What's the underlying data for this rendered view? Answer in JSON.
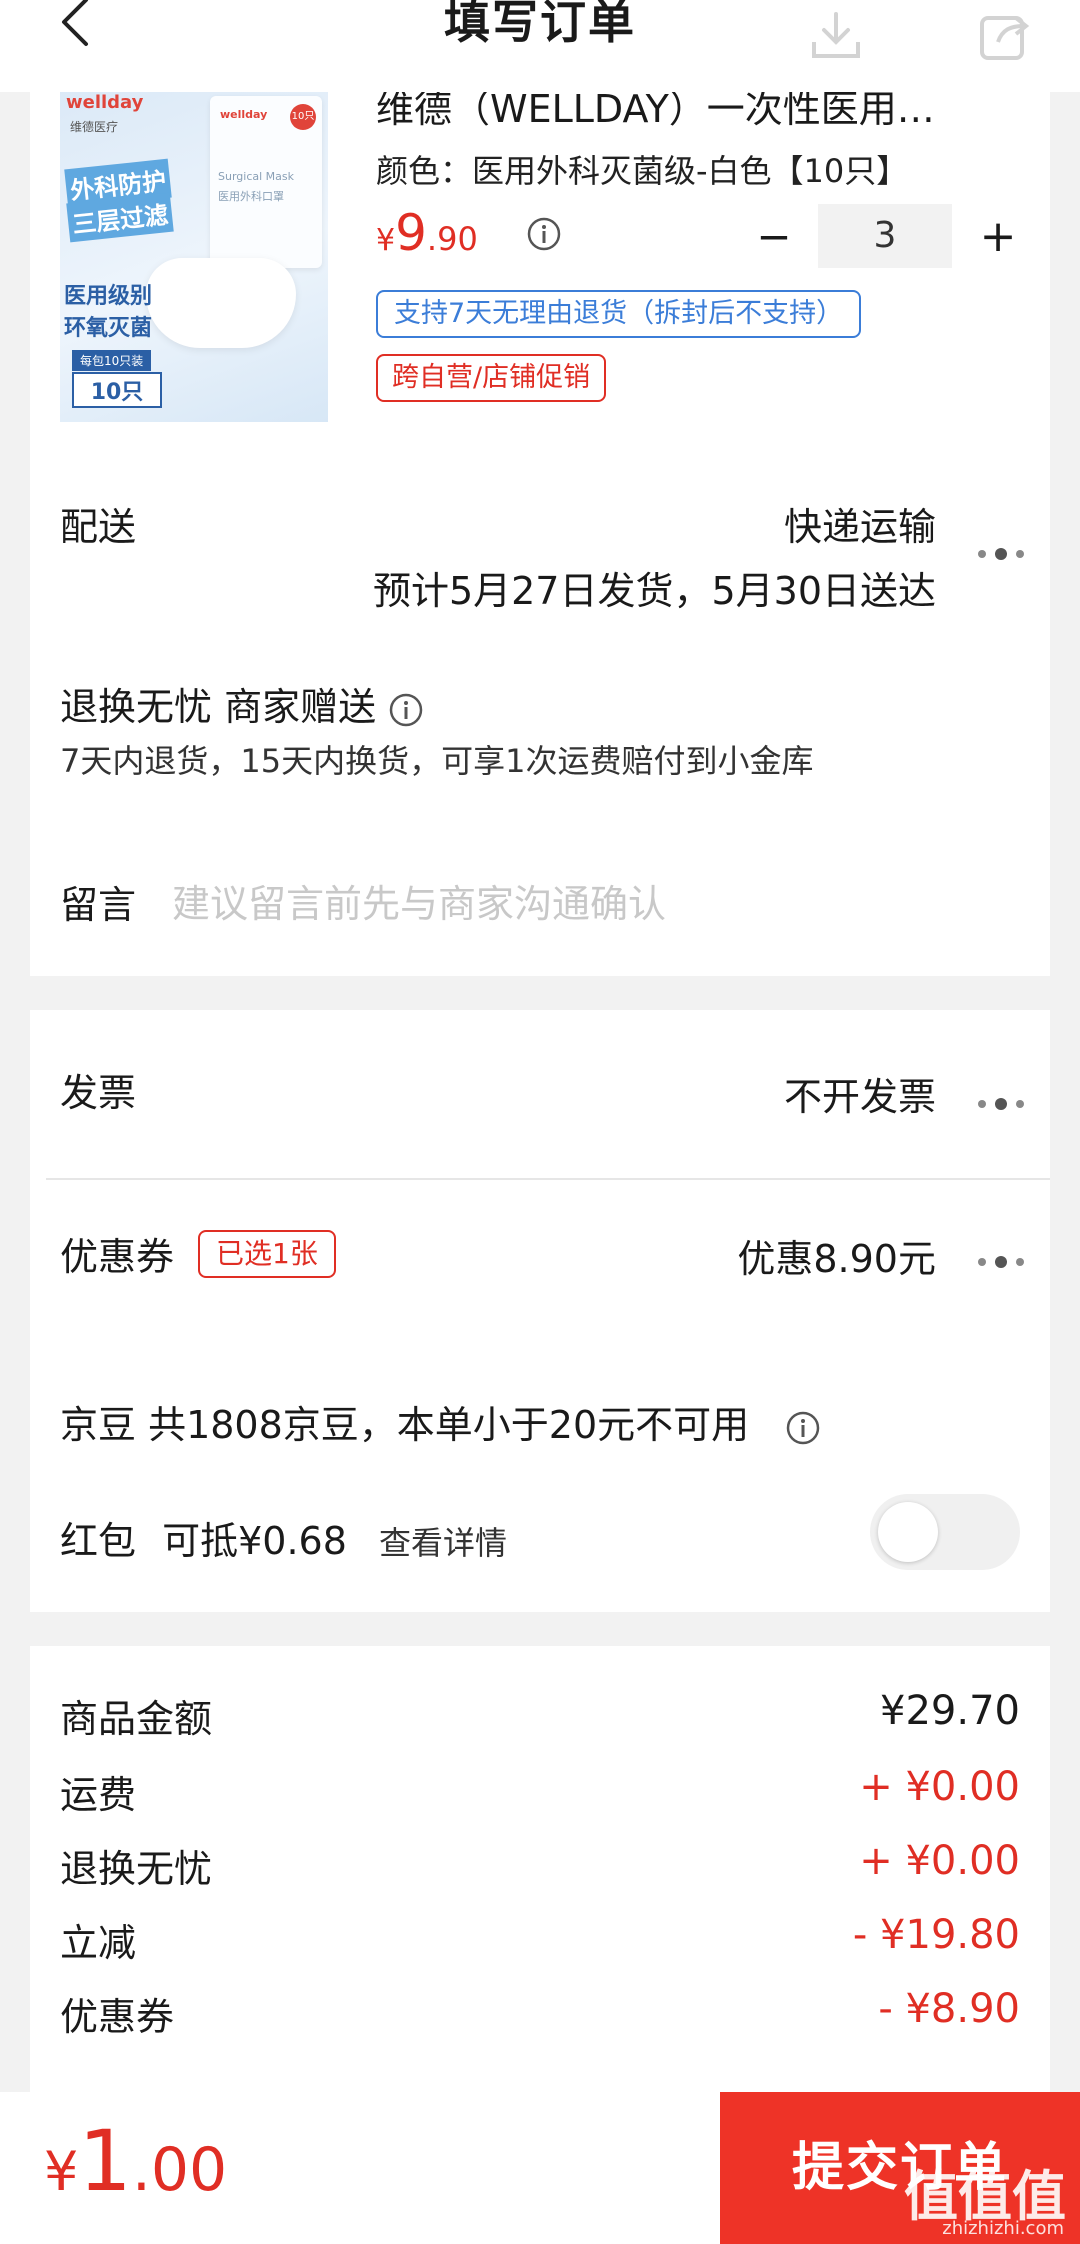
{
  "header": {
    "title": "填写订单"
  },
  "product": {
    "title": "维德（WELLDAY）一次性医用…",
    "spec": "颜色：医用外科灭菌级-白色【10只】",
    "price_symbol": "¥",
    "price_int": "9",
    "price_dec": ".90",
    "quantity": "3",
    "return_tag": "支持7天无理由退货（拆封后不支持）",
    "promo_tag": "跨自营/店铺促销",
    "image": {
      "brand": "wellday",
      "brand_cn": "维德医疗",
      "line1": "外科防护",
      "line2": "三层过滤",
      "line3": "医用级别",
      "line4": "环氧灭菌",
      "pack_note": "每包10只装",
      "count": "10只",
      "box_brand": "wellday",
      "box_en": "Surgical Mask",
      "box_cn": "医用外科口罩",
      "box_badge": "10只"
    }
  },
  "delivery": {
    "label": "配送",
    "method": "快递运输",
    "estimate": "预计5月27日发货，5月30日送达"
  },
  "worry_free": {
    "title": "退换无忧 商家赠送",
    "desc": "7天内退货，15天内换货，可享1次运费赔付到小金库"
  },
  "message": {
    "label": "留言",
    "placeholder": "建议留言前先与商家沟通确认"
  },
  "invoice": {
    "label": "发票",
    "value": "不开发票"
  },
  "coupon": {
    "label": "优惠券",
    "badge": "已选1张",
    "value": "优惠8.90元"
  },
  "jingdou": {
    "text": "京豆 共1808京豆，本单小于20元不可用"
  },
  "redpacket": {
    "label": "红包",
    "amount": "可抵¥0.68",
    "detail": "查看详情",
    "enabled": false
  },
  "summary": [
    {
      "label": "商品金额",
      "value": "¥29.70",
      "tone": "black"
    },
    {
      "label": "运费",
      "value": "+ ¥0.00",
      "tone": "red"
    },
    {
      "label": "退换无忧",
      "value": "+ ¥0.00",
      "tone": "red"
    },
    {
      "label": "立减",
      "value": "- ¥19.80",
      "tone": "red"
    },
    {
      "label": "优惠券",
      "value": "- ¥8.90",
      "tone": "red"
    }
  ],
  "bottom": {
    "total_symbol": "¥",
    "total_int": "1",
    "total_dec": ".00",
    "submit_label": "提交订单",
    "watermark": "值值值",
    "watermark_sub": "zhizhizhi.com"
  },
  "colors": {
    "accent": "#ee3327",
    "price": "#e02e24",
    "link_blue": "#3b7dd8"
  },
  "icons": [
    "back-arrow-icon",
    "download-icon",
    "share-icon",
    "info-icon",
    "more-dots-icon"
  ]
}
